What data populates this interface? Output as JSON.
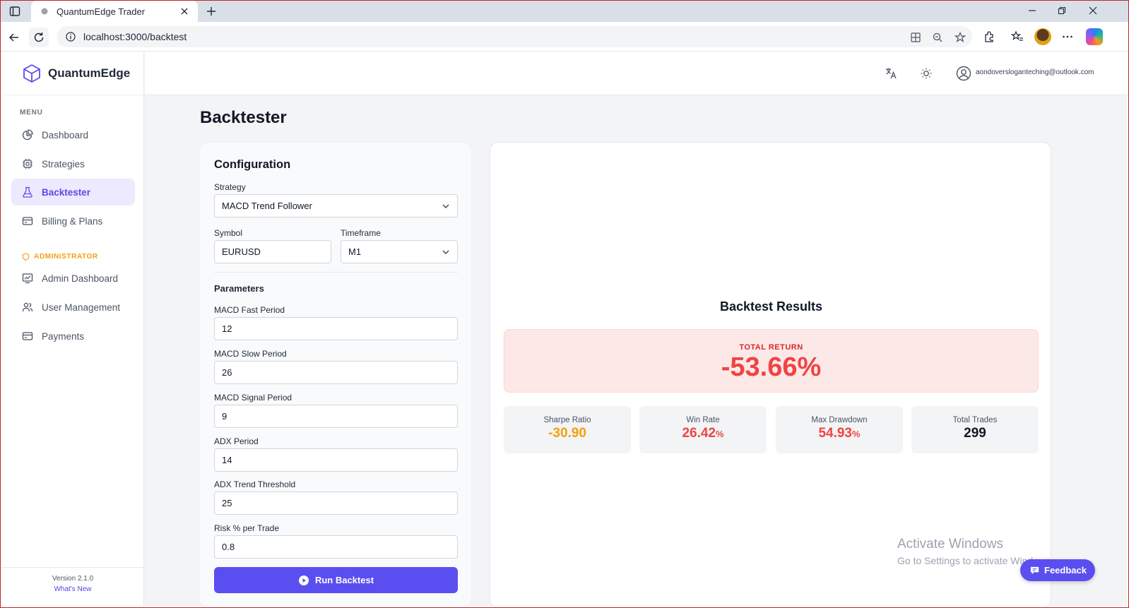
{
  "browser": {
    "tab_title": "QuantumEdge Trader",
    "url": "localhost:3000/backtest"
  },
  "sidebar": {
    "brand": "QuantumEdge",
    "menu_label": "MENU",
    "items": [
      {
        "label": "Dashboard",
        "icon": "pie-chart-icon"
      },
      {
        "label": "Strategies",
        "icon": "cpu-icon"
      },
      {
        "label": "Backtester",
        "icon": "flask-icon",
        "active": true
      },
      {
        "label": "Billing & Plans",
        "icon": "credit-card-icon"
      }
    ],
    "admin_label": "ADMINISTRATOR",
    "admin_items": [
      {
        "label": "Admin Dashboard",
        "icon": "chart-icon"
      },
      {
        "label": "User Management",
        "icon": "users-icon"
      },
      {
        "label": "Payments",
        "icon": "credit-card-icon"
      }
    ],
    "version": "Version 2.1.0",
    "whats_new": "What's New"
  },
  "topbar": {
    "user_email": "aondoversloganteching@outlook.com"
  },
  "page": {
    "title": "Backtester"
  },
  "config": {
    "title": "Configuration",
    "strategy_label": "Strategy",
    "strategy_value": "MACD Trend Follower",
    "symbol_label": "Symbol",
    "symbol_value": "EURUSD",
    "timeframe_label": "Timeframe",
    "timeframe_value": "M1",
    "parameters_title": "Parameters",
    "params": [
      {
        "label": "MACD Fast Period",
        "value": "12"
      },
      {
        "label": "MACD Slow Period",
        "value": "26"
      },
      {
        "label": "MACD Signal Period",
        "value": "9"
      },
      {
        "label": "ADX Period",
        "value": "14"
      },
      {
        "label": "ADX Trend Threshold",
        "value": "25"
      },
      {
        "label": "Risk % per Trade",
        "value": "0.8"
      }
    ],
    "run_label": "Run Backtest"
  },
  "results": {
    "title": "Backtest Results",
    "total_return_label": "TOTAL RETURN",
    "total_return_value": "-53.66%",
    "metrics": [
      {
        "label": "Sharpe Ratio",
        "value": "-30.90",
        "unit": "",
        "color": "#f59e0b"
      },
      {
        "label": "Win Rate",
        "value": "26.42",
        "unit": "%",
        "color": "#ef4444"
      },
      {
        "label": "Max Drawdown",
        "value": "54.93",
        "unit": "%",
        "color": "#ef4444"
      },
      {
        "label": "Total Trades",
        "value": "299",
        "unit": "",
        "color": "#111827"
      }
    ]
  },
  "overlay": {
    "activate_title": "Activate Windows",
    "activate_sub": "Go to Settings to activate Windows.",
    "feedback_label": "Feedback"
  }
}
